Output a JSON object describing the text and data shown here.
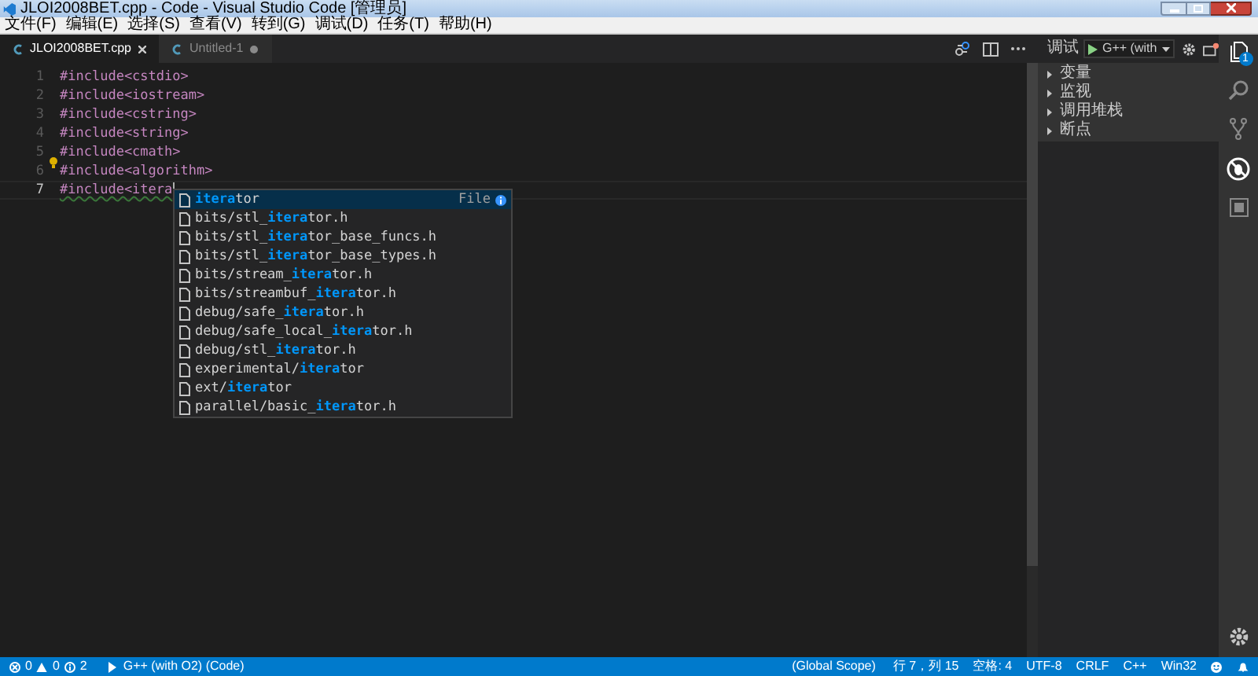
{
  "window": {
    "title": "JLOI2008BET.cpp - Code - Visual Studio Code [管理员]"
  },
  "menu": [
    "文件(F)",
    "编辑(E)",
    "选择(S)",
    "查看(V)",
    "转到(G)",
    "调试(D)",
    "任务(T)",
    "帮助(H)"
  ],
  "tabs": [
    {
      "label": "JLOI2008BET.cpp",
      "selected": true,
      "dirty": false
    },
    {
      "label": "Untitled-1",
      "selected": false,
      "dirty": true
    }
  ],
  "debug_toolbar": {
    "label": "调试",
    "configuration": "G++ (with"
  },
  "debug_sections": [
    {
      "label": "变量",
      "expanded": false
    },
    {
      "label": "监视",
      "expanded": false
    },
    {
      "label": "调用堆栈",
      "expanded": false
    },
    {
      "label": "断点",
      "expanded": false
    }
  ],
  "activity_bar": {
    "badge": "1"
  },
  "editor": {
    "lines": [
      {
        "number": "1",
        "text": "#include<cstdio>",
        "active": false
      },
      {
        "number": "2",
        "text": "#include<iostream>",
        "active": false
      },
      {
        "number": "3",
        "text": "#include<cstring>",
        "active": false
      },
      {
        "number": "4",
        "text": "#include<string>",
        "active": false
      },
      {
        "number": "5",
        "text": "#include<cmath>",
        "active": false
      },
      {
        "number": "6",
        "text": "#include<algorithm>",
        "active": false
      },
      {
        "number": "7",
        "text": "#include<itera",
        "active": true
      }
    ]
  },
  "suggestions": [
    {
      "match": "itera",
      "after": "tor",
      "selected": true,
      "detail": "File"
    },
    {
      "before": "bits/stl_",
      "match": "itera",
      "after": "tor.h",
      "selected": false
    },
    {
      "before": "bits/stl_",
      "match": "itera",
      "after": "tor_base_funcs.h",
      "selected": false
    },
    {
      "before": "bits/stl_",
      "match": "itera",
      "after": "tor_base_types.h",
      "selected": false
    },
    {
      "before": "bits/stream_",
      "match": "itera",
      "after": "tor.h",
      "selected": false
    },
    {
      "before": "bits/streambuf_",
      "match": "itera",
      "after": "tor.h",
      "selected": false
    },
    {
      "before": "debug/safe_",
      "match": "itera",
      "after": "tor.h",
      "selected": false
    },
    {
      "before": "debug/safe_local_",
      "match": "itera",
      "after": "tor.h",
      "selected": false
    },
    {
      "before": "debug/stl_",
      "match": "itera",
      "after": "tor.h",
      "selected": false
    },
    {
      "before": "experimental/",
      "match": "itera",
      "after": "tor",
      "selected": false
    },
    {
      "before": "ext/",
      "match": "itera",
      "after": "tor",
      "selected": false
    },
    {
      "before": "parallel/basic_",
      "match": "itera",
      "after": "tor.h",
      "selected": false
    }
  ],
  "status_bar": {
    "errors": "0",
    "warnings": "0",
    "infos": "2",
    "launch": "G++ (with O2) (Code)",
    "scope": "(Global Scope)",
    "position": "行 7，列 15",
    "indent": "空格: 4",
    "encoding": "UTF-8",
    "eol": "CRLF",
    "language": "C++",
    "platform": "Win32"
  }
}
